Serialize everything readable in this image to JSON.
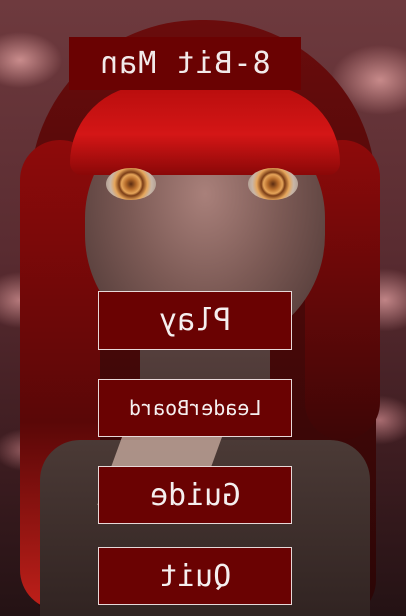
{
  "title": "8-Bit Man",
  "menu": {
    "play": "Play",
    "leaderboard": "LeaderBoard",
    "guide": "Guide",
    "quit": "Quit"
  },
  "colors": {
    "button_fill": "#6a0202",
    "button_border": "#e7d8d8",
    "text": "#f5efef"
  }
}
